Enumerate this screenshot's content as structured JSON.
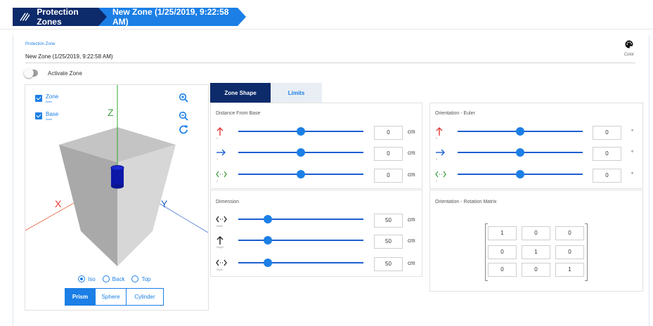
{
  "breadcrumb": {
    "root": "Protection Zones",
    "current": "New Zone (1/25/2019, 9:22:58 AM)"
  },
  "zone_field": {
    "label": "Protection Zone",
    "value": "New Zone (1/25/2019, 9:22:58 AM)"
  },
  "color_button": {
    "label": "Color",
    "icon": "palette-icon"
  },
  "activate_zone": {
    "label": "Activate Zone",
    "on": false
  },
  "viewport": {
    "axes_options": [
      {
        "label": "Zone",
        "sub": "Axes",
        "checked": true
      },
      {
        "label": "Base",
        "sub": "Axes",
        "checked": true
      }
    ],
    "axis_labels": {
      "z": "Z",
      "x": "X",
      "y": "Y"
    },
    "tools": [
      "zoom-in-icon",
      "zoom-out-icon",
      "reset-view-icon"
    ],
    "views": [
      {
        "label": "Iso",
        "selected": true
      },
      {
        "label": "Back",
        "selected": false
      },
      {
        "label": "Top",
        "selected": false
      }
    ],
    "shapes": [
      {
        "label": "Prism",
        "active": true
      },
      {
        "label": "Sphere",
        "active": false
      },
      {
        "label": "Cylinder",
        "active": false
      }
    ]
  },
  "tabs": [
    {
      "label": "Zone Shape",
      "active": true
    },
    {
      "label": "Limits",
      "active": false
    }
  ],
  "distance_from_base": {
    "title": "Distance From Base",
    "rows": [
      {
        "axis": "X",
        "icon": "arrow-up-icon",
        "color": "#e53935",
        "value": "0",
        "unit": "cm",
        "slider_fraction": 0.5
      },
      {
        "axis": "Y",
        "icon": "arrow-right-icon",
        "color": "#1c5fd1",
        "value": "0",
        "unit": "cm",
        "slider_fraction": 0.5
      },
      {
        "axis": "Z",
        "icon": "arrow-left-right-icon",
        "color": "#43a047",
        "value": "0",
        "unit": "cm",
        "slider_fraction": 0.5
      }
    ]
  },
  "orientation_euler": {
    "title": "Orientation - Euler",
    "rows": [
      {
        "axis": "X",
        "icon": "arrow-up-icon",
        "color": "#e53935",
        "value": "0",
        "unit": "°",
        "slider_fraction": 0.5
      },
      {
        "axis": "Y",
        "icon": "arrow-right-icon",
        "color": "#1c5fd1",
        "value": "0",
        "unit": "°",
        "slider_fraction": 0.5
      },
      {
        "axis": "Z",
        "icon": "arrow-left-right-icon",
        "color": "#43a047",
        "value": "0",
        "unit": "°",
        "slider_fraction": 0.5
      }
    ]
  },
  "dimension": {
    "title": "Dimension",
    "rows": [
      {
        "label": "Width",
        "icon": "arrow-left-right-icon",
        "value": "50",
        "unit": "cm",
        "slider_fraction": 0.24
      },
      {
        "label": "Height",
        "icon": "arrow-up-icon",
        "value": "50",
        "unit": "cm",
        "slider_fraction": 0.24
      },
      {
        "label": "Depth",
        "icon": "arrow-left-right-icon",
        "value": "50",
        "unit": "cm",
        "slider_fraction": 0.24
      }
    ]
  },
  "rotation_matrix": {
    "title": "Orientation - Rotation Matrix",
    "values": [
      [
        "1",
        "0",
        "0"
      ],
      [
        "0",
        "1",
        "0"
      ],
      [
        "0",
        "0",
        "1"
      ]
    ]
  },
  "colors": {
    "brand_dark": "#0d2a6b",
    "brand_blue": "#1c7fe6",
    "axis_x": "#e53935",
    "axis_y": "#1c5fd1",
    "axis_z": "#43a047"
  }
}
